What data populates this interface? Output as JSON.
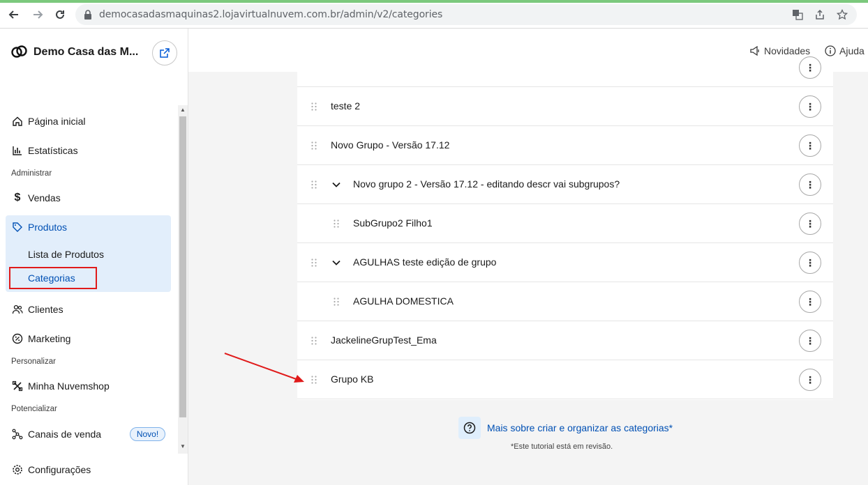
{
  "browser": {
    "url": "democasadasmaquinas2.lojavirtualnuvem.com.br/admin/v2/categories"
  },
  "sidebar": {
    "store_name": "Demo Casa das M...",
    "items": {
      "home": "Página inicial",
      "stats": "Estatísticas",
      "section_admin": "Administrar",
      "sales": "Vendas",
      "products": "Produtos",
      "product_list": "Lista de Produtos",
      "categories": "Categorias",
      "clients": "Clientes",
      "marketing": "Marketing",
      "section_custom": "Personalizar",
      "my_store": "Minha Nuvemshop",
      "section_boost": "Potencializar",
      "channels": "Canais de venda",
      "channels_badge": "Novo!",
      "settings": "Configurações"
    }
  },
  "topbar": {
    "news": "Novidades",
    "help": "Ajuda"
  },
  "categories": [
    {
      "label": "teste 2",
      "indent": 0,
      "expandable": false
    },
    {
      "label": "Novo Grupo - Versão 17.12",
      "indent": 0,
      "expandable": false
    },
    {
      "label": "Novo grupo 2 - Versão 17.12 - editando descr vai subgrupos?",
      "indent": 0,
      "expandable": true
    },
    {
      "label": "SubGrupo2 Filho1",
      "indent": 1,
      "expandable": false
    },
    {
      "label": "AGULHAS teste edição de grupo",
      "indent": 0,
      "expandable": true
    },
    {
      "label": "AGULHA DOMESTICA",
      "indent": 1,
      "expandable": false
    },
    {
      "label": "JackelineGrupTest_Ema",
      "indent": 0,
      "expandable": false
    },
    {
      "label": "Grupo KB",
      "indent": 0,
      "expandable": false
    }
  ],
  "help": {
    "link": "Mais sobre criar e organizar as categorias*",
    "note": "*Este tutorial está em revisão."
  },
  "colors": {
    "accent": "#0050b4",
    "active_bg": "#e2eefb",
    "highlight_box": "#e01a1a",
    "annotation_arrow": "#e01a1a"
  }
}
